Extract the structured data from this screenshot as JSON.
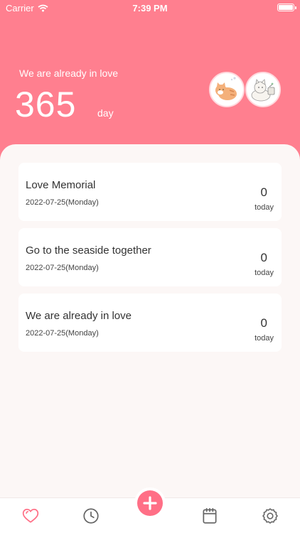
{
  "status_bar": {
    "carrier": "Carrier",
    "time": "7:39 PM"
  },
  "header": {
    "caption": "We are already in love",
    "days": "365",
    "unit": "day"
  },
  "events": [
    {
      "title": "Love Memorial",
      "date": "2022-07-25(Monday)",
      "count": "0",
      "unit": "today"
    },
    {
      "title": "Go to the seaside together",
      "date": "2022-07-25(Monday)",
      "count": "0",
      "unit": "today"
    },
    {
      "title": "We are already in love",
      "date": "2022-07-25(Monday)",
      "count": "0",
      "unit": "today"
    }
  ],
  "tab_bar": {
    "tabs": [
      "heart-icon",
      "clock-icon",
      "add-icon",
      "calendar-icon",
      "settings-icon"
    ],
    "active": "heart-icon"
  },
  "colors": {
    "header": "#ff7f8f",
    "background": "#fcf7f6",
    "accent": "#ff6f86",
    "inactive_icon": "#666666"
  }
}
